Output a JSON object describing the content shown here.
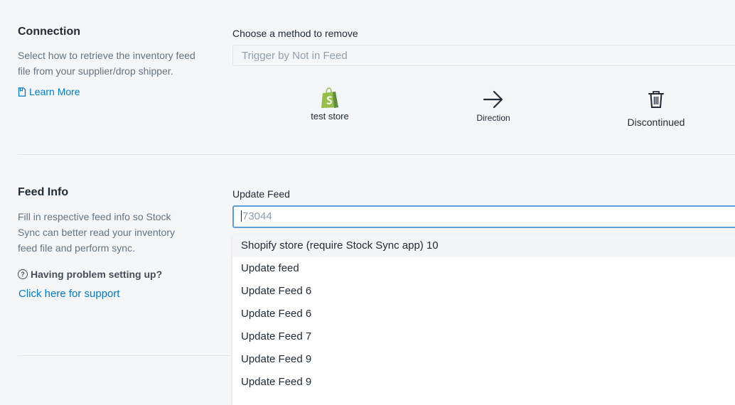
{
  "connection": {
    "title": "Connection",
    "description": "Select how to retrieve the inventory feed file from your supplier/drop shipper.",
    "learn_more": "Learn More",
    "method_label": "Choose a method to remove",
    "method_value": "Trigger by Not in Feed",
    "flow": {
      "source_label": "test store",
      "source_icon": "shopify-bag-icon",
      "direction_label": "Direction",
      "direction_icon": "arrow-right-icon",
      "target_label": "Discontinued",
      "target_icon": "trash-icon"
    }
  },
  "feed_info": {
    "title": "Feed Info",
    "description": "Fill in respective feed info so Stock Sync can better read your inventory feed file and perform sync.",
    "help_text": "Having problem setting up?",
    "support_link": "Click here for support",
    "update_feed_label": "Update Feed",
    "update_feed_placeholder": "73044",
    "dropdown_options": [
      "Shopify store (require Stock Sync app) 10",
      "Update feed",
      "Update Feed 6",
      "Update Feed 6",
      "Update Feed 7",
      "Update Feed 9",
      "Update Feed 9"
    ]
  },
  "colors": {
    "link": "#007ace",
    "focus_border": "#5c9edb",
    "shopify_green": "#95bf47"
  }
}
